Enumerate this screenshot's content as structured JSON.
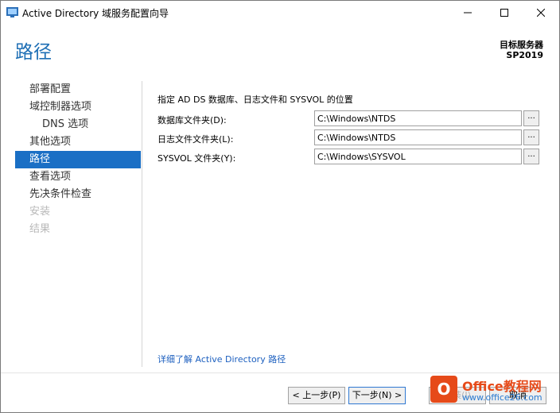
{
  "window": {
    "title": "Active Directory 域服务配置向导"
  },
  "header": {
    "page_title": "路径",
    "target_label": "目标服务器",
    "target_value": "SP2019"
  },
  "sidebar": {
    "items": [
      {
        "label": "部署配置",
        "state": "normal"
      },
      {
        "label": "域控制器选项",
        "state": "normal"
      },
      {
        "label": "DNS 选项",
        "state": "sub"
      },
      {
        "label": "其他选项",
        "state": "normal"
      },
      {
        "label": "路径",
        "state": "active"
      },
      {
        "label": "查看选项",
        "state": "normal"
      },
      {
        "label": "先决条件检查",
        "state": "normal"
      },
      {
        "label": "安装",
        "state": "disabled"
      },
      {
        "label": "结果",
        "state": "disabled"
      }
    ]
  },
  "content": {
    "instruction": "指定 AD DS 数据库、日志文件和 SYSVOL 的位置",
    "rows": [
      {
        "label": "数据库文件夹(D):",
        "value": "C:\\Windows\\NTDS"
      },
      {
        "label": "日志文件文件夹(L):",
        "value": "C:\\Windows\\NTDS"
      },
      {
        "label": "SYSVOL 文件夹(Y):",
        "value": "C:\\Windows\\SYSVOL"
      }
    ],
    "browse_label": "...",
    "learn_more": "详细了解 Active Directory 路径"
  },
  "footer": {
    "prev": "< 上一步(P)",
    "next": "下一步(N) >",
    "install": "安装(I)",
    "cancel": "取消"
  },
  "watermark": {
    "icon_text": "O",
    "brand": "Office教程网",
    "url": "www.office26.com"
  },
  "colors": {
    "accent": "#1a6fc5",
    "title": "#1e6fb5",
    "link": "#1c5fbf",
    "watermark": "#e64a19"
  }
}
